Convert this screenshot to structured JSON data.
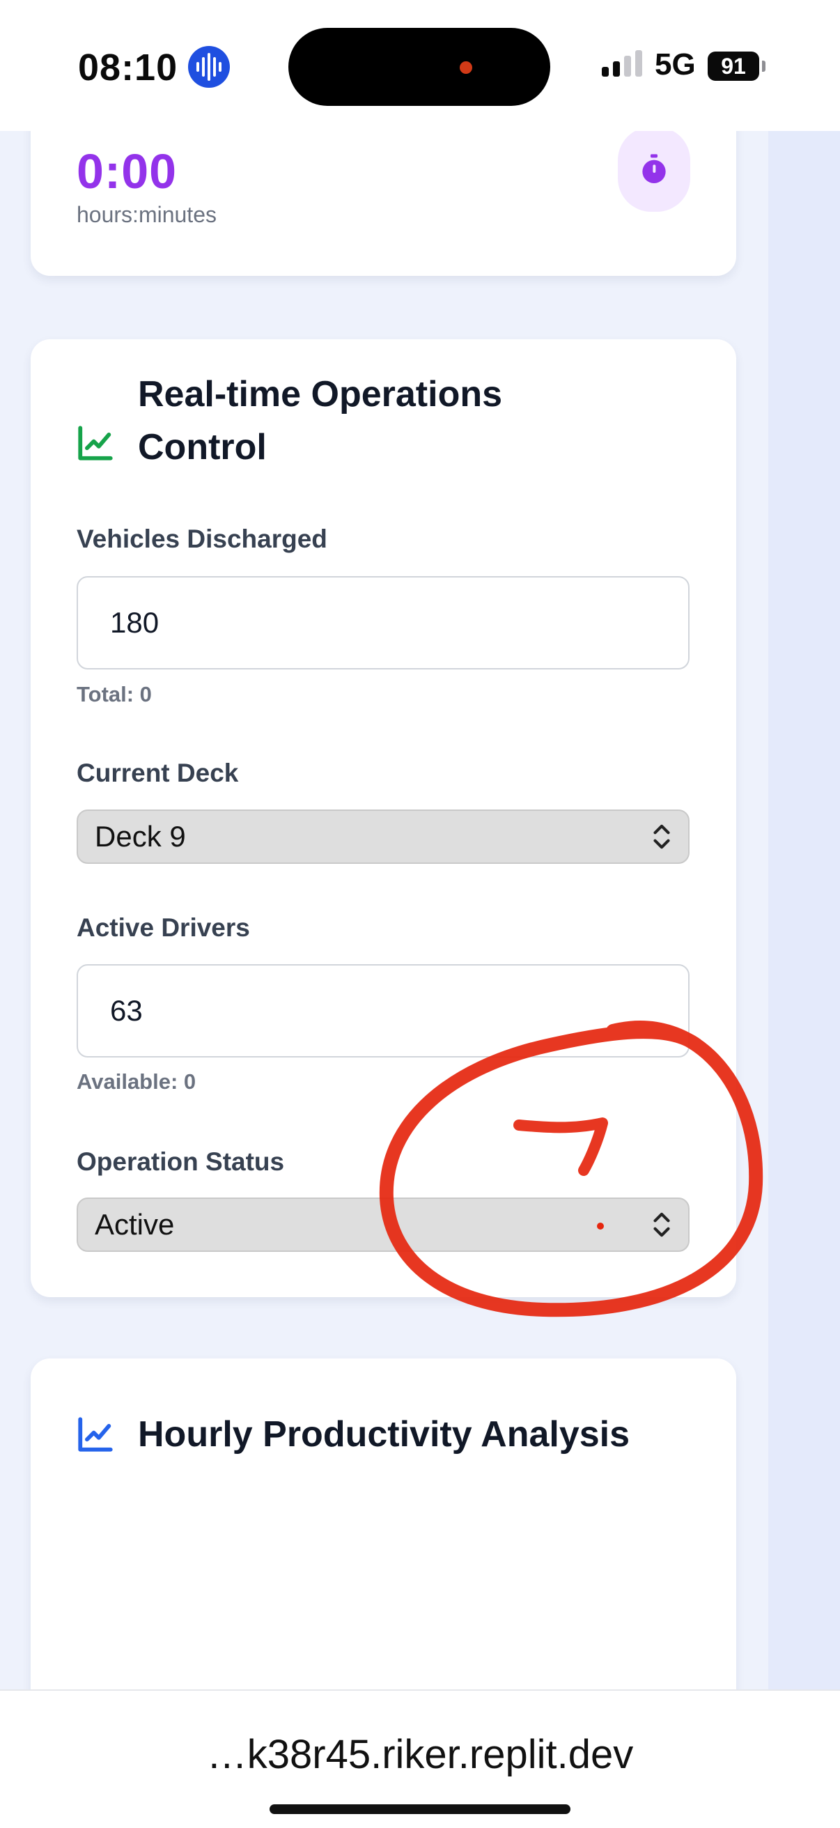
{
  "status_bar": {
    "time": "08:10",
    "network": "5G",
    "battery": "91"
  },
  "timer_card": {
    "value": "0:00",
    "unit_label": "hours:minutes",
    "icon": "stopwatch-icon"
  },
  "operations_card": {
    "icon": "trending-up-icon",
    "title_line1": "Real-time Operations",
    "title_line2": "Control",
    "vehicles_discharged": {
      "label": "Vehicles Discharged",
      "value": "180",
      "hint": "Total: 0"
    },
    "current_deck": {
      "label": "Current Deck",
      "selected": "Deck 9"
    },
    "active_drivers": {
      "label": "Active Drivers",
      "value": "63",
      "hint": "Available: 0"
    },
    "operation_status": {
      "label": "Operation Status",
      "selected": "Active"
    }
  },
  "productivity_card": {
    "icon": "trending-up-icon",
    "title": "Hourly Productivity Analysis"
  },
  "address_bar": {
    "url": "…k38r45.riker.replit.dev"
  },
  "colors": {
    "accent_purple": "#9333ea",
    "icon_green": "#16a34a",
    "icon_blue": "#2563eb",
    "annotation_red": "#e5260e"
  }
}
